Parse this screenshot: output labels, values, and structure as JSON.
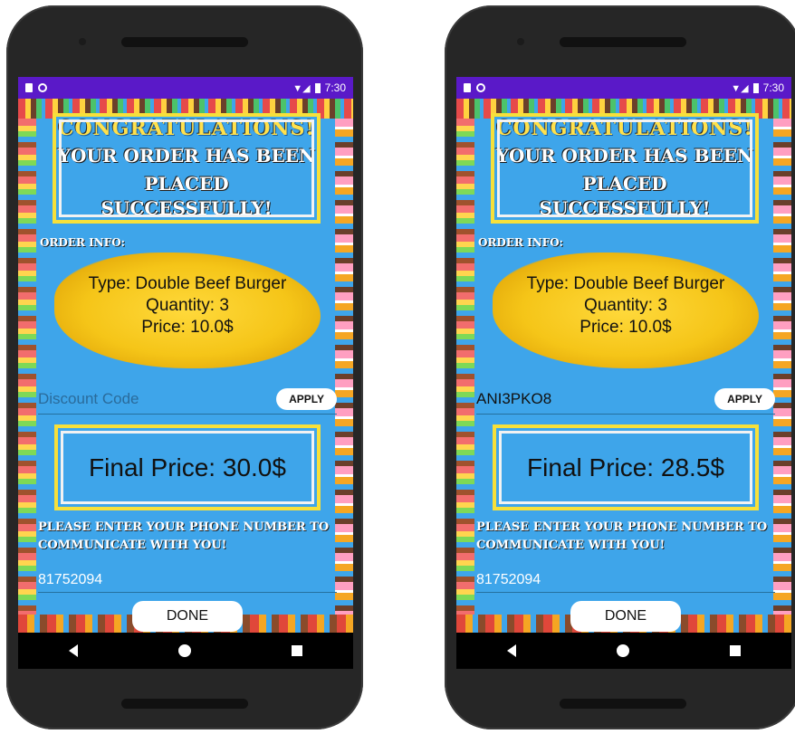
{
  "status_bar": {
    "time": "7:30"
  },
  "header": {
    "congrats_line": "CONGRATULATIONS!",
    "message_line1": "YOUR ORDER HAS BEEN",
    "message_line2": "PLACED SUCCESSFULLY!"
  },
  "order": {
    "label": "ORDER INFO:",
    "type": "Type: Double Beef Burger",
    "quantity": "Quantity: 3",
    "price": "Price: 10.0$"
  },
  "discount": {
    "placeholder": "Discount Code",
    "apply_label": "APPLY"
  },
  "phone_prompt": "PLEASE ENTER YOUR PHONE NUMBER TO COMMUNICATE WITH YOU!",
  "done_label": "DONE",
  "screens": [
    {
      "discount_value": "",
      "final_price": "Final Price: 30.0$",
      "phone_number": "81752094"
    },
    {
      "discount_value": "ANI3PKO8",
      "final_price": "Final Price: 28.5$",
      "phone_number": "81752094"
    }
  ],
  "colors": {
    "background": "#3ea5ea",
    "status_bar": "#5a19c8",
    "accent_yellow": "#f7e03a"
  }
}
